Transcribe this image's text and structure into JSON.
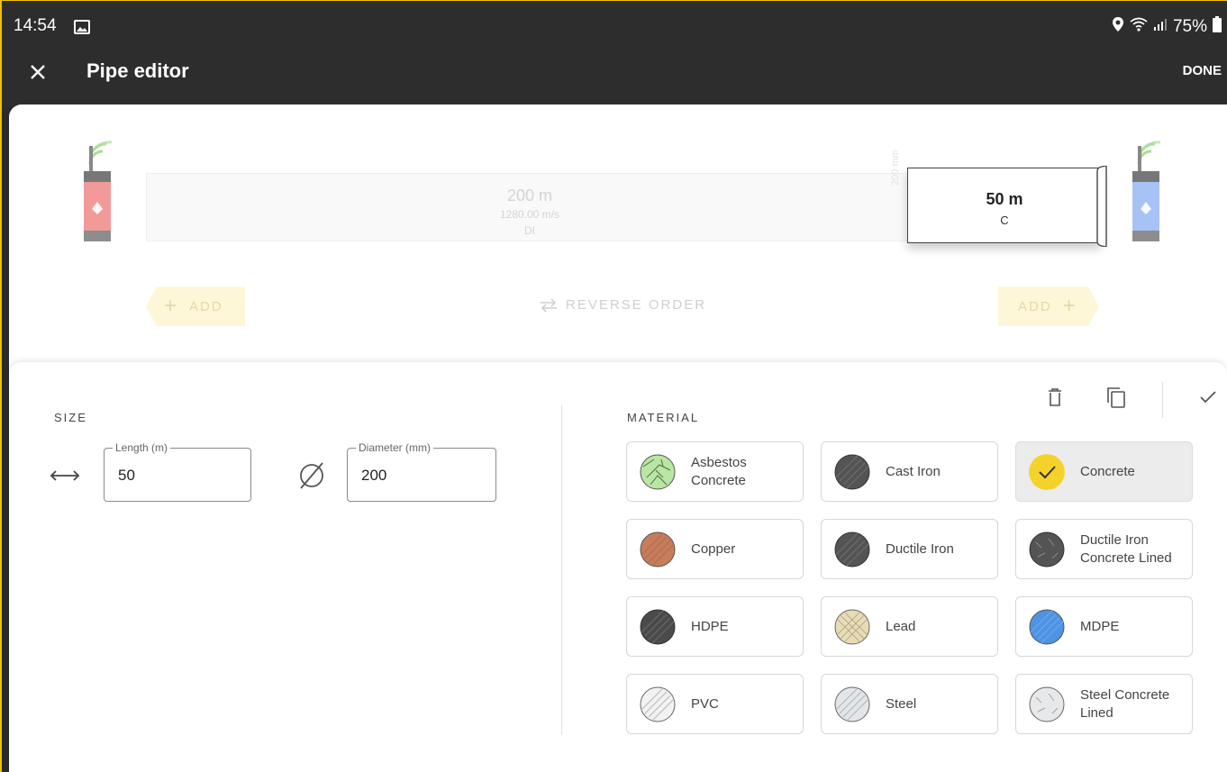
{
  "status_bar": {
    "time": "14:54",
    "battery": "75%",
    "icons": [
      "gallery-icon",
      "location-icon",
      "wifi-icon",
      "signal-icon",
      "battery-icon"
    ]
  },
  "app_bar": {
    "title": "Pipe editor",
    "done_label": "DONE",
    "close_icon": "close-icon"
  },
  "pipe": {
    "segments": [
      {
        "length": "200 m",
        "speed": "1280.00 m/s",
        "material": "DI",
        "diameter_vertical": "200 mm"
      }
    ],
    "selected_segment": {
      "length": "50 m",
      "material": "C"
    },
    "add_left_label": "ADD",
    "add_right_label": "ADD",
    "reverse_label": "REVERSE ORDER"
  },
  "editor": {
    "size_label": "SIZE",
    "material_label": "MATERIAL",
    "length_legend": "Length (m)",
    "length_value": "50",
    "diameter_legend": "Diameter (mm)",
    "diameter_value": "200",
    "materials": [
      {
        "name": "Asbestos\nConcrete",
        "icon": "asbestos-concrete-icon"
      },
      {
        "name": "Cast Iron",
        "icon": "cast-iron-icon"
      },
      {
        "name": "Concrete",
        "icon": "check-icon",
        "selected": true
      },
      {
        "name": "Copper",
        "icon": "copper-icon"
      },
      {
        "name": "Ductile Iron",
        "icon": "ductile-iron-icon"
      },
      {
        "name": "Ductile Iron\nConcrete Lined",
        "icon": "ductile-iron-concrete-lined-icon"
      },
      {
        "name": "HDPE",
        "icon": "hdpe-icon"
      },
      {
        "name": "Lead",
        "icon": "lead-icon"
      },
      {
        "name": "MDPE",
        "icon": "mdpe-icon"
      },
      {
        "name": "PVC",
        "icon": "pvc-icon"
      },
      {
        "name": "Steel",
        "icon": "steel-icon"
      },
      {
        "name": "Steel Concrete\nLined",
        "icon": "steel-concrete-lined-icon"
      }
    ]
  },
  "colors": {
    "app_bar": "#2d2d2d",
    "accent_yellow": "#f5d22a",
    "sensor_left": "#f28b8b",
    "sensor_right": "#9ab8f5",
    "signal_green": "#8bd17a"
  }
}
